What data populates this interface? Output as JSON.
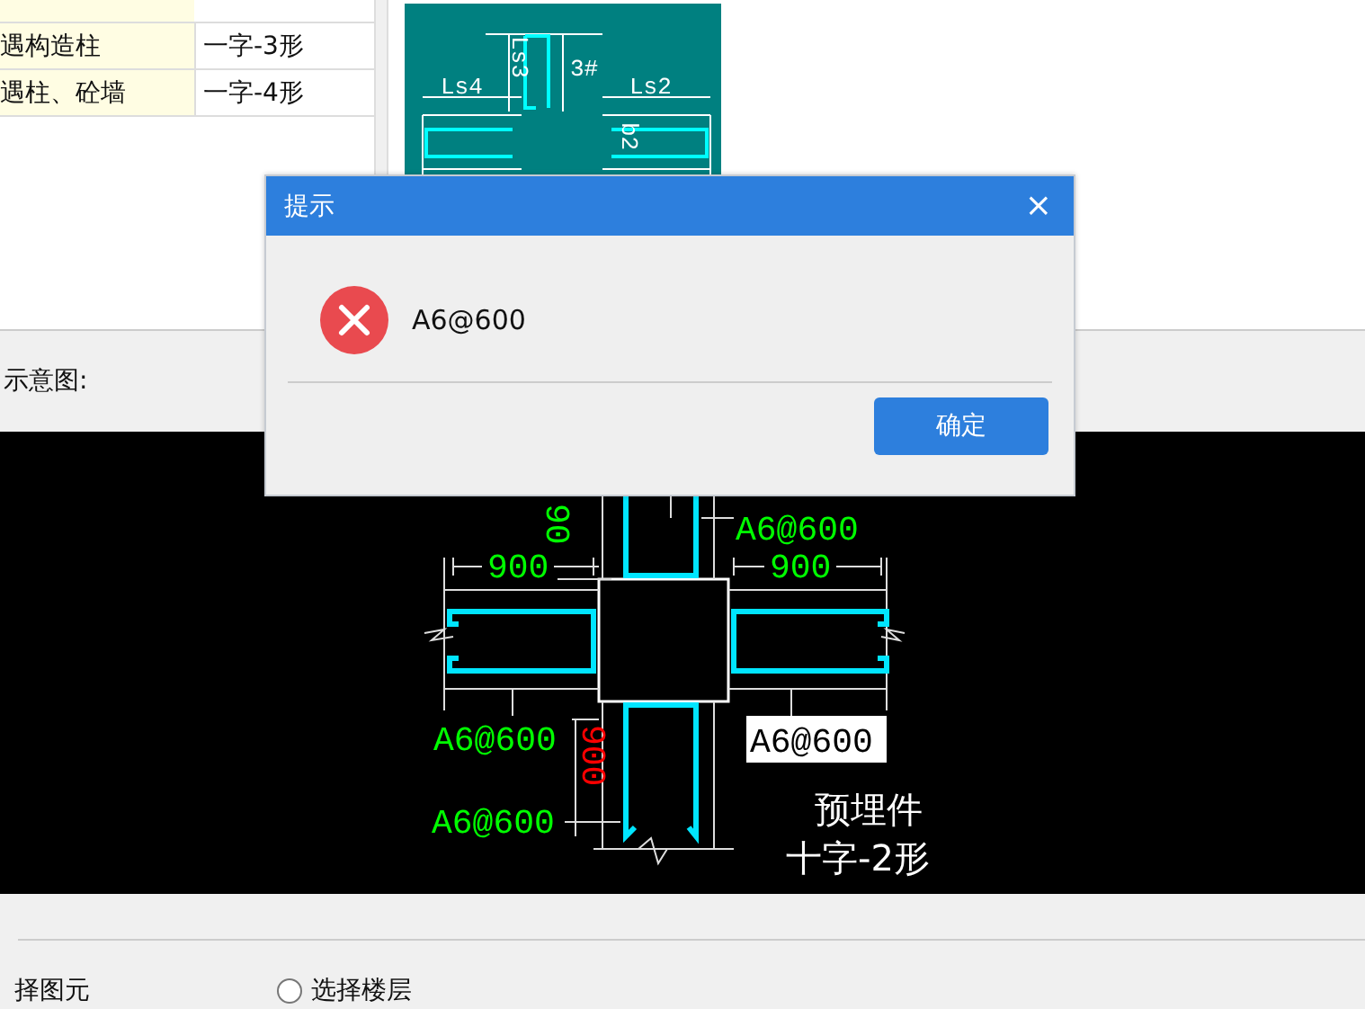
{
  "table": {
    "rows": [
      {
        "cells": [
          "遇构造柱",
          "一字-3形"
        ]
      },
      {
        "cells": [
          "遇柱、砼墙",
          "一字-4形"
        ]
      }
    ]
  },
  "preview": {
    "labels": [
      {
        "text": "Ls3",
        "kind": "vertical"
      },
      {
        "text": "3#",
        "kind": "horizontal"
      },
      {
        "text": "Ls4",
        "kind": "horizontal"
      },
      {
        "text": "Ls2",
        "kind": "horizontal"
      },
      {
        "text": "b2",
        "kind": "vertical"
      }
    ]
  },
  "diagram_label": "示意图:",
  "diagram": {
    "labels": [
      {
        "text": "90",
        "kind": "vertical",
        "color": "#00ff00"
      },
      {
        "text": "A6@600",
        "kind": "horizontal",
        "color": "#00ff00"
      },
      {
        "text": "900",
        "kind": "horizontal",
        "color": "#00ff00"
      },
      {
        "text": "900",
        "kind": "horizontal",
        "color": "#00ff00"
      },
      {
        "text": "A6@600",
        "kind": "horizontal",
        "color": "#00ff00"
      },
      {
        "text": "900",
        "kind": "vertical",
        "color": "#ff0000"
      },
      {
        "text": "A6@600",
        "kind": "horizontal",
        "color": "#00ff00"
      }
    ],
    "callout": "A6@600",
    "caption": [
      "预埋件",
      "十字-2形"
    ]
  },
  "options": [
    {
      "label": "择图元"
    },
    {
      "label": "选择楼层",
      "selected": false
    }
  ],
  "dialog": {
    "title": "提示",
    "close": "×",
    "message": "A6@600",
    "button": "确定"
  }
}
